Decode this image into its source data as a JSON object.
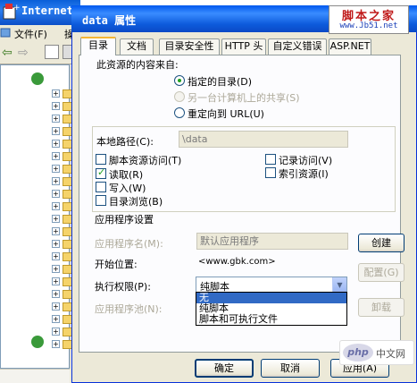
{
  "background_window": {
    "title": "Internet",
    "menu_file": "文件(F)",
    "menu_next": "操"
  },
  "dialog": {
    "title": "data 属性",
    "tabs": [
      "目录",
      "文档",
      "目录安全性",
      "HTTP 头",
      "自定义错误",
      "ASP.NET"
    ],
    "active_tab": "目录",
    "content_source_label": "此资源的内容来自:",
    "radio_options": [
      {
        "label": "指定的目录(D)",
        "checked": true,
        "enabled": true
      },
      {
        "label": "另一台计算机上的共享(S)",
        "checked": false,
        "enabled": false
      },
      {
        "label": "重定向到 URL(U)",
        "checked": false,
        "enabled": true
      }
    ],
    "local_path_label": "本地路径(C):",
    "local_path_value": "\\data",
    "checkboxes_left": [
      {
        "label": "脚本资源访问(T)",
        "checked": false
      },
      {
        "label": "读取(R)",
        "checked": true
      },
      {
        "label": "写入(W)",
        "checked": false
      },
      {
        "label": "目录浏览(B)",
        "checked": false
      }
    ],
    "checkboxes_right": [
      {
        "label": "记录访问(V)",
        "checked": false
      },
      {
        "label": "索引资源(I)",
        "checked": false
      }
    ],
    "app_settings_label": "应用程序设置",
    "app_name_label": "应用程序名(M):",
    "app_name_value": "默认应用程序",
    "create_button": "创建",
    "start_point_label": "开始位置:",
    "start_point_value": "<www.gbk.com>",
    "config_button": "配置(G)",
    "exec_perm_label": "执行权限(P):",
    "exec_perm_value": "纯脚本",
    "exec_perm_options": [
      "无",
      "纯脚本",
      "脚本和可执行文件"
    ],
    "exec_perm_highlighted": "无",
    "app_pool_label": "应用程序池(N):",
    "unload_button": "卸载",
    "ok_button": "确定",
    "cancel_button": "取消",
    "apply_button": "应用(A)"
  },
  "watermarks": {
    "site_title": "脚本之家",
    "site_url": "www.Jb51.net",
    "php_logo": "php",
    "php_text": "中文网"
  },
  "colors": {
    "title_bar": "#0a5fd8",
    "dialog_bg": "#ece9d8",
    "selection": "#316ac5",
    "check_green": "#21a121"
  }
}
